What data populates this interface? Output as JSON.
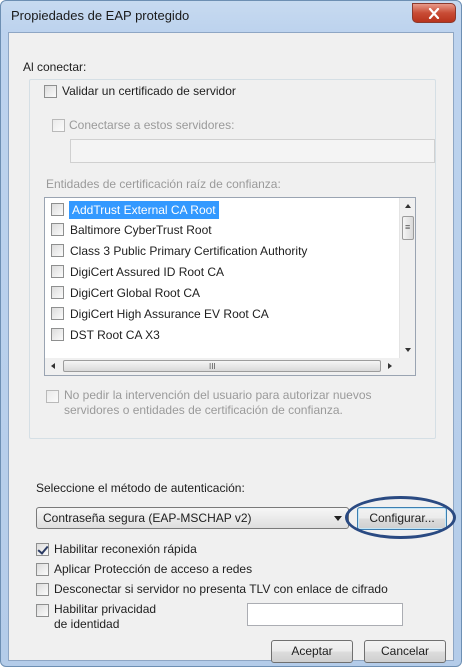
{
  "window": {
    "title": "Propiedades de EAP protegido",
    "close_label": "x"
  },
  "connect": {
    "heading": "Al conectar:",
    "validate_cert": {
      "label": "Validar un certificado de servidor",
      "checked": false
    },
    "connect_servers": {
      "label": "Conectarse a estos servidores:",
      "checked": false,
      "value": ""
    },
    "root_ca_label": "Entidades de certificación raíz de confianza:",
    "ca_list": [
      {
        "label": "AddTrust External CA Root",
        "checked": false,
        "selected": true
      },
      {
        "label": "Baltimore CyberTrust Root",
        "checked": false,
        "selected": false
      },
      {
        "label": "Class 3 Public Primary Certification Authority",
        "checked": false,
        "selected": false
      },
      {
        "label": "DigiCert Assured ID Root CA",
        "checked": false,
        "selected": false
      },
      {
        "label": "DigiCert Global Root CA",
        "checked": false,
        "selected": false
      },
      {
        "label": "DigiCert High Assurance EV Root CA",
        "checked": false,
        "selected": false
      },
      {
        "label": "DST Root CA X3",
        "checked": false,
        "selected": false
      }
    ],
    "hscroll_grip": "III",
    "no_prompt": {
      "line1": "No pedir la intervención del usuario para autorizar nuevos",
      "line2": "servidores o entidades de certificación de confianza.",
      "checked": false
    }
  },
  "auth": {
    "label": "Seleccione el método de autenticación:",
    "method": "Contraseña segura (EAP-MSCHAP v2)",
    "configure_button": "Configurar..."
  },
  "options": {
    "fast_reconnect": {
      "label": "Habilitar reconexión rápida",
      "checked": true
    },
    "nap": {
      "label": "Aplicar Protección de acceso a redes",
      "checked": false
    },
    "disconnect_tlv": {
      "label": "Desconectar si servidor no presenta TLV con enlace de cifrado",
      "checked": false
    },
    "identity_privacy": {
      "line1": "Habilitar privacidad",
      "line2": "de identidad",
      "checked": false,
      "value": ""
    }
  },
  "buttons": {
    "ok": "Aceptar",
    "cancel": "Cancelar"
  },
  "colors": {
    "selection": "#3399ff",
    "annotation_ellipse": "#2a4a82",
    "close_button": "#c84c35"
  }
}
